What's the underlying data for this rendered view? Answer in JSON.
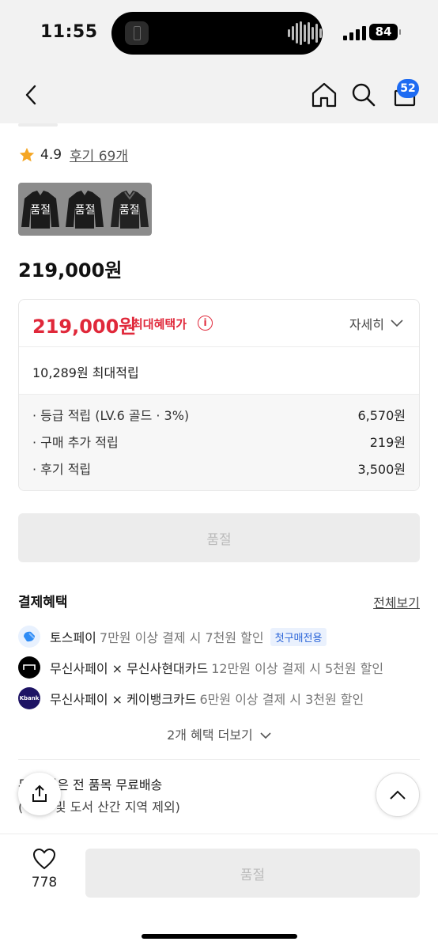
{
  "status_bar": {
    "time": "11:55",
    "battery": "84"
  },
  "nav": {
    "cart_count": "52"
  },
  "rating": {
    "score": "4.9",
    "reviews": "후기 69개"
  },
  "thumbnails": [
    {
      "label": "품절"
    },
    {
      "label": "품절"
    },
    {
      "label": "품절"
    }
  ],
  "price": "219,000원",
  "benefit_box": {
    "max_price": "219,000원",
    "max_label": "최대혜택가",
    "info_icon": "i",
    "detail_label": "자세히",
    "points_total": "10,289원 최대적립",
    "rows": [
      {
        "label": "· 등급 적립 (LV.6 골드 · 3%)",
        "amount": "6,570원"
      },
      {
        "label": "· 구매 추가 적립",
        "amount": "219원"
      },
      {
        "label": "· 후기 적립",
        "amount": "3,500원"
      }
    ]
  },
  "soldout_button": "품절",
  "payment": {
    "title": "결제혜택",
    "view_all": "전체보기",
    "items": [
      {
        "name": "토스페이",
        "desc": "7만원 이상 결제 시 7천원 할인",
        "tag": "첫구매전용",
        "logo_color": "#2f8cf5",
        "icon": "toss-icon"
      },
      {
        "name": "무신사페이 × 무신사현대카드",
        "desc": "12만원 이상 결제 시 5천원 할인",
        "logo_color": "#000000",
        "icon": "musinsa-card-icon"
      },
      {
        "name": "무신사페이 × 케이뱅크카드",
        "desc": "6만원 이상 결제 시 3천원 할인",
        "logo_color": "#1d1364",
        "logo_text": "Kbank",
        "icon": "kbank-icon"
      }
    ],
    "more": "2개 혜택 더보기"
  },
  "shipping": {
    "line1": "무      회원은 전 품목 무료배송",
    "line2": "(     상품 및 도서 산간 지역 제외)"
  },
  "bottom": {
    "like_count": "778",
    "buy_label": "품절"
  },
  "colors": {
    "accent_red": "#e0283a",
    "badge_blue": "#1e6bf2",
    "star": "#f5a623"
  }
}
